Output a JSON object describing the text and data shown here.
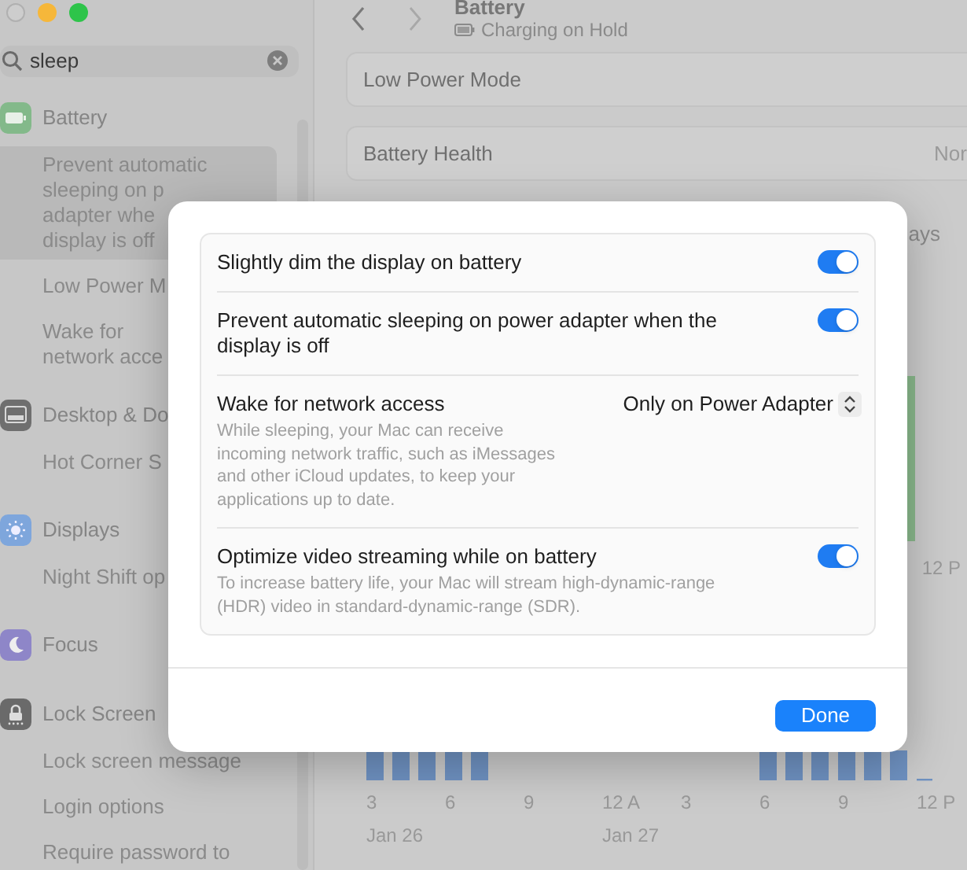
{
  "sidebar": {
    "search": {
      "value": "sleep"
    },
    "groups": [
      {
        "title": "Battery",
        "kind": "battery",
        "items": [
          {
            "lines": [
              "Prevent automatic",
              "sleeping on p",
              "adapter whe",
              "display is off"
            ],
            "selected": true
          },
          {
            "lines": [
              "Low Power M"
            ],
            "selected": false
          },
          {
            "lines": [
              "Wake for",
              "network acce"
            ],
            "selected": false
          }
        ]
      },
      {
        "title": "Desktop & Do",
        "kind": "desktop",
        "items": [
          {
            "lines": [
              "Hot Corner S"
            ],
            "selected": false
          }
        ]
      },
      {
        "title": "Displays",
        "kind": "displays",
        "items": [
          {
            "lines": [
              "Night Shift op"
            ],
            "selected": false
          }
        ]
      },
      {
        "title": "Focus",
        "kind": "focus"
      },
      {
        "title": "Lock Screen",
        "kind": "lock",
        "items": [
          {
            "lines": [
              "Lock screen message"
            ],
            "selected": false
          },
          {
            "lines": [
              "Login options"
            ],
            "selected": false
          },
          {
            "lines": [
              "Require password to"
            ],
            "selected": false
          }
        ]
      }
    ]
  },
  "header": {
    "title": "Battery",
    "subtitle": "Charging on Hold"
  },
  "rows": [
    {
      "label": "Low Power Mode"
    },
    {
      "label": "Battery Health",
      "value": "Nor"
    }
  ],
  "period_picker": {
    "label": "ays"
  },
  "level_chart": {
    "x_label": "12 P"
  },
  "usage_chart": {
    "x_labels": [
      {
        "label": "3",
        "date": "Jan 26"
      },
      {
        "label": "6"
      },
      {
        "label": "9"
      },
      {
        "label": "12 A",
        "date": "Jan 27"
      },
      {
        "label": "3"
      },
      {
        "label": "6"
      },
      {
        "label": "9"
      },
      {
        "label": "12 P"
      }
    ]
  },
  "dialog": {
    "settings": [
      {
        "kind": "toggle",
        "title": "Slightly dim the display on battery",
        "on": true
      },
      {
        "kind": "toggle",
        "title": "Prevent automatic sleeping on power adapter when the display is off",
        "on": true
      },
      {
        "kind": "popup",
        "title": "Wake for network access",
        "description": "While sleeping, your Mac can receive incoming network traffic, such as iMessages and other iCloud updates, to keep your applications up to date.",
        "value": "Only on Power Adapter"
      },
      {
        "kind": "toggle",
        "title": "Optimize video streaming while on battery",
        "description": "To increase battery life, your Mac will stream high-dynamic-range (HDR) video in standard-dynamic-range (SDR).",
        "on": true
      }
    ],
    "button": "Done"
  }
}
